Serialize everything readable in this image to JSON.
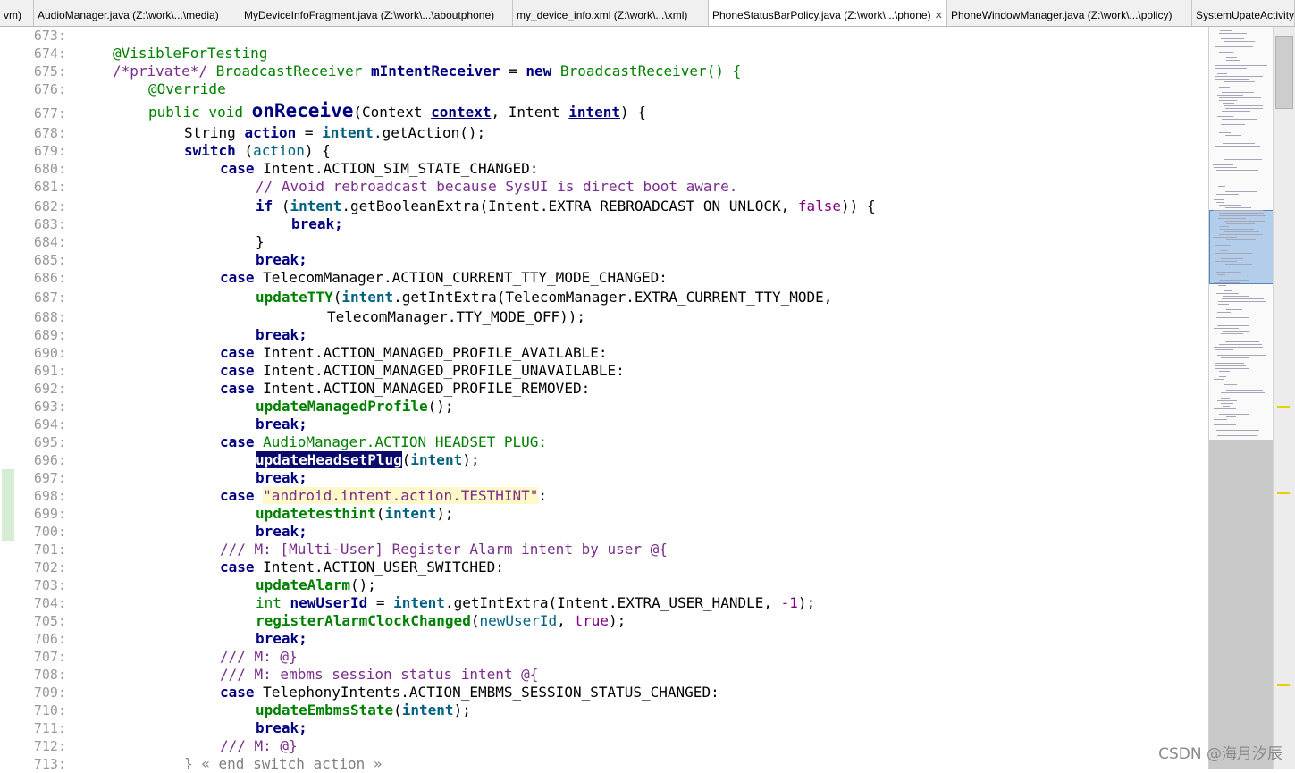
{
  "tabs": [
    {
      "label": "vm)",
      "active": false,
      "width": 38
    },
    {
      "label": "AudioManager.java (Z:\\work\\...\\media)",
      "active": false,
      "width": 231
    },
    {
      "label": "MyDeviceInfoFragment.java (Z:\\work\\...\\aboutphone)",
      "active": false,
      "width": 305
    },
    {
      "label": "my_device_info.xml (Z:\\work\\...\\xml)",
      "active": false,
      "width": 219
    },
    {
      "label": "PhoneStatusBarPolicy.java (Z:\\work\\...\\phone)",
      "active": true,
      "width": 267
    },
    {
      "label": "PhoneWindowManager.java (Z:\\work\\...\\policy)",
      "active": false,
      "width": 274
    },
    {
      "label": "SystemUpateActivity",
      "active": false,
      "width": 115
    }
  ],
  "line_numbers": [
    "673:",
    "674:",
    "675:",
    "676:",
    "677:",
    "678:",
    "679:",
    "680:",
    "681:",
    "682:",
    "683:",
    "684:",
    "685:",
    "686:",
    "687:",
    "688:",
    "689:",
    "690:",
    "691:",
    "692:",
    "693:",
    "694:",
    "695:",
    "696:",
    "697:",
    "698:",
    "699:",
    "700:",
    "701:",
    "702:",
    "703:",
    "704:",
    "705:",
    "706:",
    "707:",
    "708:",
    "709:",
    "710:",
    "711:",
    "712:",
    "713:"
  ],
  "code": {
    "l674": "@VisibleForTesting",
    "l675": [
      "/*private*/ ",
      "BroadcastReceiver ",
      "mIntentReceiver",
      " = ",
      "new",
      " BroadcastReceiver() {"
    ],
    "l676": "@Override",
    "l677": [
      "public void ",
      "onReceive",
      "(Context ",
      "context",
      ", Intent ",
      "intent",
      ") {"
    ],
    "l678": [
      "String ",
      "action",
      " = ",
      "intent",
      ".getAction();"
    ],
    "l679": [
      "switch",
      " (",
      "action",
      ") {"
    ],
    "l680": [
      "case",
      " Intent.ACTION_SIM_STATE_CHANGED:"
    ],
    "l681": "// Avoid rebroadcast because SysUI is direct boot aware.",
    "l682": [
      "if",
      " (",
      "intent",
      ".getBooleanExtra(Intent.EXTRA_REBROADCAST_ON_UNLOCK, ",
      "false",
      ")) {"
    ],
    "l683": "break;",
    "l684": "}",
    "l685": "break;",
    "l686": [
      "case",
      " TelecomManager.ACTION_CURRENT_TTY_MODE_CHANGED:"
    ],
    "l687": [
      "updateTTY",
      "(",
      "intent",
      ".getIntExtra(TelecomManager.EXTRA_CURRENT_TTY_MODE,"
    ],
    "l688": "TelecomManager.TTY_MODE_OFF));",
    "l689": "break;",
    "l690": [
      "case",
      " Intent.ACTION_MANAGED_PROFILE_AVAILABLE:"
    ],
    "l691": [
      "case",
      " Intent.ACTION_MANAGED_PROFILE_UNAVAILABLE:"
    ],
    "l692": [
      "case",
      " Intent.ACTION_MANAGED_PROFILE_REMOVED:"
    ],
    "l693": [
      "updateManagedProfile",
      "();"
    ],
    "l694": "break;",
    "l695": [
      "case",
      " AudioManager.ACTION_HEADSET_PLUG:"
    ],
    "l696": [
      "updateHeadsetPlug",
      "(",
      "intent",
      ");"
    ],
    "l697": "break;",
    "l698": [
      "case",
      " ",
      "\"android.intent.action.TESTHINT\"",
      ":"
    ],
    "l699": [
      "updatetesthint",
      "(",
      "intent",
      ");"
    ],
    "l700": "break;",
    "l701": "/// M: [Multi-User] Register Alarm intent by user @{",
    "l702": [
      "case",
      " Intent.ACTION_USER_SWITCHED:"
    ],
    "l703": [
      "updateAlarm",
      "();"
    ],
    "l704": [
      "int ",
      "newUserId",
      " = ",
      "intent",
      ".getIntExtra(Intent.EXTRA_USER_HANDLE, ",
      "-1",
      ");"
    ],
    "l705": [
      "registerAlarmClockChanged",
      "(",
      "newUserId",
      ", ",
      "true",
      ");"
    ],
    "l706": "break;",
    "l707": "/// M: @}",
    "l708": "/// M: embms session status intent @{",
    "l709": [
      "case",
      " TelephonyIntents.ACTION_EMBMS_SESSION_STATUS_CHANGED:"
    ],
    "l710": [
      "updateEmbmsState",
      "(",
      "intent",
      ");"
    ],
    "l711": "break;",
    "l712": "/// M: @}",
    "l713": "} « end switch action »"
  },
  "watermark": "CSDN @海月汐辰",
  "icons": {
    "tab_close": "close-icon"
  }
}
